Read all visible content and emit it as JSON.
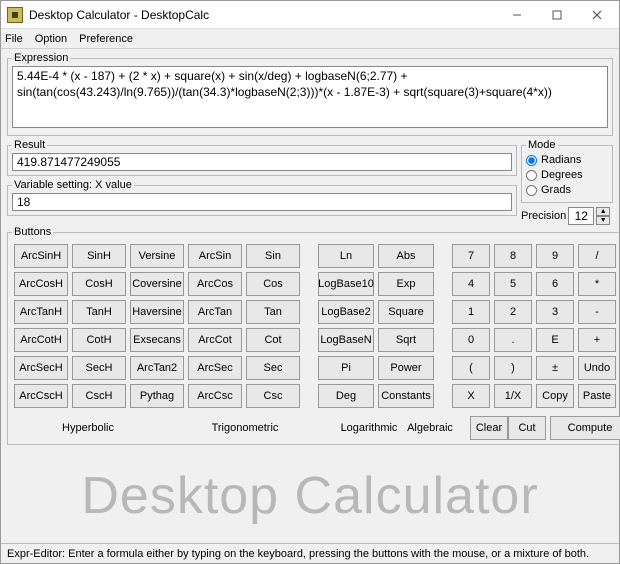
{
  "window": {
    "title": "Desktop Calculator - DesktopCalc"
  },
  "menu": {
    "file": "File",
    "option": "Option",
    "preference": "Preference"
  },
  "expression": {
    "legend": "Expression",
    "value": "5.44E-4 * (x - 187) + (2 * x) + square(x) + sin(x/deg) + logbaseN(6;2.77) + sin(tan(cos(43.243)/ln(9.765))/(tan(34.3)*logbaseN(2;3)))*(x - 1.87E-3) + sqrt(square(3)+square(4*x))"
  },
  "result": {
    "legend": "Result",
    "value": "419.871477249055"
  },
  "variable": {
    "legend": "Variable setting: X value",
    "value": "18"
  },
  "mode": {
    "legend": "Mode",
    "radians": "Radians",
    "degrees": "Degrees",
    "grads": "Grads",
    "selected": "radians"
  },
  "precision": {
    "label": "Precision",
    "value": "12"
  },
  "buttons": {
    "legend": "Buttons",
    "grid": [
      [
        "ArcSinH",
        "SinH",
        "Versine",
        "ArcSin",
        "Sin",
        "Ln",
        "Abs",
        "7",
        "8",
        "9",
        "/"
      ],
      [
        "ArcCosH",
        "CosH",
        "Coversine",
        "ArcCos",
        "Cos",
        "LogBase10",
        "Exp",
        "4",
        "5",
        "6",
        "*"
      ],
      [
        "ArcTanH",
        "TanH",
        "Haversine",
        "ArcTan",
        "Tan",
        "LogBase2",
        "Square",
        "1",
        "2",
        "3",
        "-"
      ],
      [
        "ArcCotH",
        "CotH",
        "Exsecans",
        "ArcCot",
        "Cot",
        "LogBaseN",
        "Sqrt",
        "0",
        ".",
        "E",
        "+"
      ],
      [
        "ArcSecH",
        "SecH",
        "ArcTan2",
        "ArcSec",
        "Sec",
        "Pi",
        "Power",
        "(",
        ")",
        "±",
        "Undo"
      ],
      [
        "ArcCscH",
        "CscH",
        "Pythag",
        "ArcCsc",
        "Csc",
        "Deg",
        "Constants",
        "X",
        "1/X",
        "Copy",
        "Paste"
      ]
    ],
    "footer": {
      "hyperbolic": "Hyperbolic",
      "trigonometric": "Trigonometric",
      "logarithmic": "Logarithmic",
      "algebraic": "Algebraic",
      "clear": "Clear",
      "cut": "Cut",
      "compute": "Compute"
    }
  },
  "banner": "Desktop Calculator",
  "status": "Expr-Editor: Enter a formula either by typing on the keyboard, pressing the buttons with the mouse, or a mixture of both."
}
